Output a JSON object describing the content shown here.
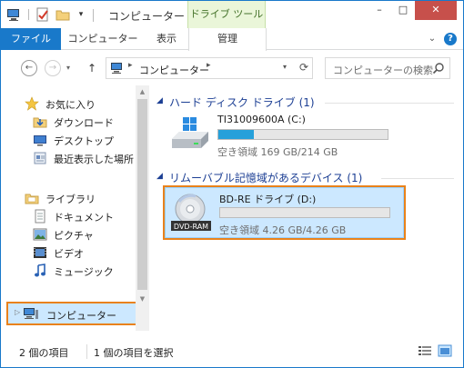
{
  "title_bar": {
    "window_title": "コンピューター",
    "contextual_tab": "ドライブ ツール",
    "dropdown_glyph": "▾",
    "minimize": "–",
    "maximize": "□",
    "close": "✕"
  },
  "ribbon": {
    "tabs": [
      {
        "label": "ファイル",
        "active": true
      },
      {
        "label": "コンピューター"
      },
      {
        "label": "表示"
      },
      {
        "label": "管理"
      }
    ],
    "collapse_glyph": "⌄",
    "help_glyph": "?"
  },
  "navigation": {
    "back_glyph": "←",
    "forward_glyph": "→",
    "recent_glyph": "▾",
    "up_glyph": "↑",
    "address": {
      "path": [
        "コンピューター"
      ],
      "separator": "▸",
      "dropdown_glyph": "▾",
      "refresh_glyph": "⟳"
    },
    "search": {
      "placeholder": "コンピューターの検索"
    }
  },
  "nav_pane": {
    "favorites": {
      "label": "お気に入り",
      "items": [
        {
          "label": "ダウンロード",
          "icon": "downloads-icon"
        },
        {
          "label": "デスクトップ",
          "icon": "desktop-icon"
        },
        {
          "label": "最近表示した場所",
          "icon": "recent-places-icon"
        }
      ]
    },
    "libraries": {
      "label": "ライブラリ",
      "items": [
        {
          "label": "ドキュメント",
          "icon": "documents-icon"
        },
        {
          "label": "ピクチャ",
          "icon": "pictures-icon"
        },
        {
          "label": "ビデオ",
          "icon": "videos-icon"
        },
        {
          "label": "ミュージック",
          "icon": "music-icon"
        }
      ]
    },
    "computer": {
      "label": "コンピューター",
      "expand_glyph": "▷",
      "selected": true
    }
  },
  "content": {
    "groups": [
      {
        "title": "ハード ディスク ドライブ (1)",
        "drives": [
          {
            "name": "TI31009600A (C:)",
            "free_text": "空き領域 169 GB/214 GB",
            "used_fraction": 0.21,
            "selected": false
          }
        ]
      },
      {
        "title": "リムーバブル記憶域があるデバイス (1)",
        "drives": [
          {
            "name": "BD-RE ドライブ (D:)",
            "free_text": "空き領域 4.26 GB/4.26 GB",
            "used_fraction": 0.0,
            "selected": true,
            "badge": "DVD-RAM"
          }
        ]
      }
    ]
  },
  "status_bar": {
    "item_count": "2 個の項目",
    "selection": "1 個の項目を選択"
  },
  "colors": {
    "accent": "#1979ca",
    "highlight_border": "#e9821b",
    "selection_fill": "#cce8ff",
    "usage_bar": "#26a0da",
    "group_header": "#1c3f94"
  }
}
